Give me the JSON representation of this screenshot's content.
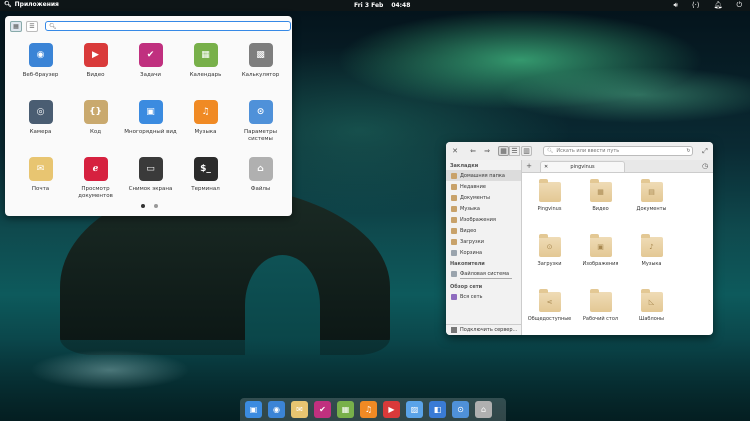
{
  "panel": {
    "apps_label": "Приложения",
    "date": "Fri 3 Feb",
    "time": "04:48",
    "icons": [
      "volume-icon",
      "network-icon",
      "notifications-icon",
      "power-icon"
    ]
  },
  "app_menu": {
    "search_value": "",
    "view_modes": [
      "grid-view-icon",
      "category-view-icon"
    ],
    "apps": [
      {
        "label": "Веб-браузер",
        "icon": "web-browser-icon",
        "color": "#3b84d6"
      },
      {
        "label": "Видео",
        "icon": "videos-icon",
        "color": "#d93a3a"
      },
      {
        "label": "Задачи",
        "icon": "tasks-icon",
        "color": "#c0307f"
      },
      {
        "label": "Календарь",
        "icon": "calendar-icon",
        "color": "#78b04a"
      },
      {
        "label": "Калькулятор",
        "icon": "calculator-icon",
        "color": "#7e7e7e"
      },
      {
        "label": "Камера",
        "icon": "camera-icon",
        "color": "#4a5d72"
      },
      {
        "label": "Код",
        "icon": "code-icon",
        "color": "#c9a96e"
      },
      {
        "label": "Многорядный вид",
        "icon": "multitasking-view-icon",
        "color": "#3b8be0"
      },
      {
        "label": "Музыка",
        "icon": "music-icon",
        "color": "#f08a24"
      },
      {
        "label": "Параметры системы",
        "icon": "system-settings-icon",
        "color": "#4f91d9"
      },
      {
        "label": "Почта",
        "icon": "mail-icon",
        "color": "#e8c571"
      },
      {
        "label": "Просмотр документов",
        "icon": "document-viewer-icon",
        "color": "#d6213f"
      },
      {
        "label": "Снимок экрана",
        "icon": "screenshot-icon",
        "color": "#3a3a3a"
      },
      {
        "label": "Терминал",
        "icon": "terminal-icon",
        "color": "#2b2b2b"
      },
      {
        "label": "Файлы",
        "icon": "files-icon",
        "color": "#b0b0b0"
      }
    ],
    "pages": 2,
    "current_page": 1
  },
  "files_window": {
    "path_placeholder": "Искать или ввести путь",
    "tab_label": "pingvinus",
    "sidebar": {
      "sections": [
        {
          "title": "Закладки",
          "items": [
            {
              "label": "Домашняя папка",
              "icon": "home-icon",
              "active": true
            },
            {
              "label": "Недавние",
              "icon": "recent-icon"
            },
            {
              "label": "Документы",
              "icon": "documents-icon"
            },
            {
              "label": "Музыка",
              "icon": "music-folder-icon"
            },
            {
              "label": "Изображения",
              "icon": "pictures-icon"
            },
            {
              "label": "Видео",
              "icon": "videos-folder-icon"
            },
            {
              "label": "Загрузки",
              "icon": "downloads-icon"
            },
            {
              "label": "Корзина",
              "icon": "trash-icon"
            }
          ]
        },
        {
          "title": "Накопители",
          "items": [
            {
              "label": "Файловая система",
              "icon": "filesystem-icon"
            }
          ]
        },
        {
          "title": "Обзор сети",
          "items": [
            {
              "label": "Вся сеть",
              "icon": "network-icon"
            }
          ]
        }
      ],
      "connect_label": "Подключить сервер..."
    },
    "folders": [
      {
        "label": "Pingvinus",
        "glyph": ""
      },
      {
        "label": "Видео",
        "glyph": "▦"
      },
      {
        "label": "Документы",
        "glyph": "▤"
      },
      {
        "label": "Загрузки",
        "glyph": "⊙"
      },
      {
        "label": "Изображения",
        "glyph": "▣"
      },
      {
        "label": "Музыка",
        "glyph": "♪"
      },
      {
        "label": "Общедоступные",
        "glyph": "⋖"
      },
      {
        "label": "Рабочий стол",
        "glyph": ""
      },
      {
        "label": "Шаблоны",
        "glyph": "◺"
      }
    ]
  },
  "dock": [
    {
      "icon": "multitasking-view-icon",
      "color": "#3b8be0"
    },
    {
      "icon": "web-browser-icon",
      "color": "#3b84d6"
    },
    {
      "icon": "mail-icon",
      "color": "#e8c571"
    },
    {
      "icon": "tasks-icon",
      "color": "#c0307f"
    },
    {
      "icon": "calendar-icon",
      "color": "#78b04a"
    },
    {
      "icon": "music-icon",
      "color": "#f08a24"
    },
    {
      "icon": "videos-icon",
      "color": "#d93a3a"
    },
    {
      "icon": "photos-icon",
      "color": "#5aa3e8"
    },
    {
      "icon": "app-center-icon",
      "color": "#3a7bd5"
    },
    {
      "icon": "system-settings-icon",
      "color": "#4f91d9"
    },
    {
      "icon": "files-icon",
      "color": "#b0b0b0"
    }
  ]
}
